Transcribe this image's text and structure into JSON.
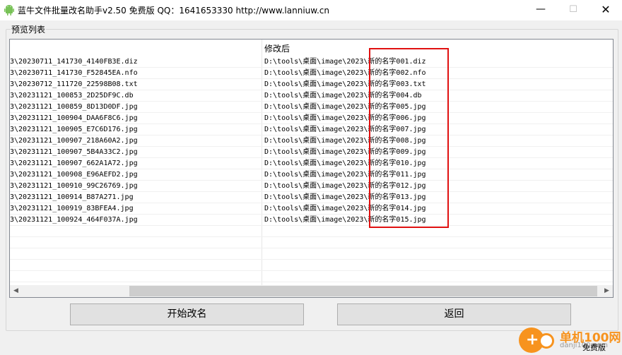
{
  "window": {
    "title": "蓝牛文件批量改名助手v2.50 免费版 QQ：1641653330  http://www.lanniuw.cn",
    "minimize": "—",
    "maximize": "☐",
    "close": "✕"
  },
  "preview": {
    "group_label": "预览列表",
    "col_new_header": "修改后",
    "rows": [
      {
        "orig": "3\\20230711_141730_4140FB3E.diz",
        "new": "D:\\tools\\桌面\\image\\2023\\新的名字001.diz"
      },
      {
        "orig": "3\\20230711_141730_F52845EA.nfo",
        "new": "D:\\tools\\桌面\\image\\2023\\新的名字002.nfo"
      },
      {
        "orig": "3\\20230712_111720_22598B08.txt",
        "new": "D:\\tools\\桌面\\image\\2023\\新的名字003.txt"
      },
      {
        "orig": "3\\20231121_100853_2D25DF9C.db",
        "new": "D:\\tools\\桌面\\image\\2023\\新的名字004.db"
      },
      {
        "orig": "3\\20231121_100859_8D13D0DF.jpg",
        "new": "D:\\tools\\桌面\\image\\2023\\新的名字005.jpg"
      },
      {
        "orig": "3\\20231121_100904_DAA6F8C6.jpg",
        "new": "D:\\tools\\桌面\\image\\2023\\新的名字006.jpg"
      },
      {
        "orig": "3\\20231121_100905_E7C6D176.jpg",
        "new": "D:\\tools\\桌面\\image\\2023\\新的名字007.jpg"
      },
      {
        "orig": "3\\20231121_100907_218A60A2.jpg",
        "new": "D:\\tools\\桌面\\image\\2023\\新的名字008.jpg"
      },
      {
        "orig": "3\\20231121_100907_5B4A33C2.jpg",
        "new": "D:\\tools\\桌面\\image\\2023\\新的名字009.jpg"
      },
      {
        "orig": "3\\20231121_100907_662A1A72.jpg",
        "new": "D:\\tools\\桌面\\image\\2023\\新的名字010.jpg"
      },
      {
        "orig": "3\\20231121_100908_E96AEFD2.jpg",
        "new": "D:\\tools\\桌面\\image\\2023\\新的名字011.jpg"
      },
      {
        "orig": "3\\20231121_100910_99C26769.jpg",
        "new": "D:\\tools\\桌面\\image\\2023\\新的名字012.jpg"
      },
      {
        "orig": "3\\20231121_100914_B87A271.jpg",
        "new": "D:\\tools\\桌面\\image\\2023\\新的名字013.jpg"
      },
      {
        "orig": "3\\20231121_100919_83BFEA4.jpg",
        "new": "D:\\tools\\桌面\\image\\2023\\新的名字014.jpg"
      },
      {
        "orig": "3\\20231121_100924_464F037A.jpg",
        "new": "D:\\tools\\桌面\\image\\2023\\新的名字015.jpg"
      }
    ]
  },
  "buttons": {
    "start": "开始改名",
    "back": "返回"
  },
  "watermark": {
    "name": "单机100网",
    "url": "danji100.com",
    "tag": "免费版"
  },
  "scroll_arrows": {
    "left": "◀",
    "right": "▶"
  },
  "icons": {
    "app": "android-icon",
    "watermark_logo": "danji-logo-icon"
  },
  "colors": {
    "highlight_box": "#e01010",
    "watermark": "#f7931e"
  }
}
